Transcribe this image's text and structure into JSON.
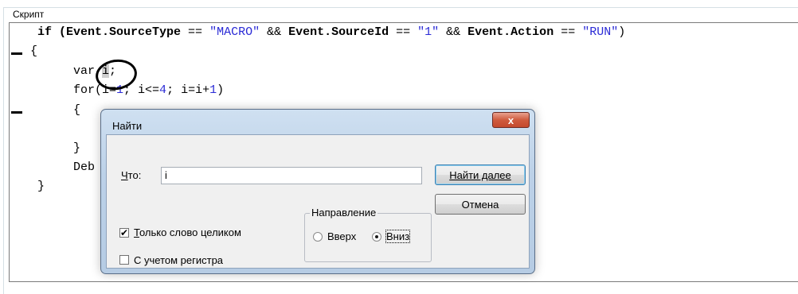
{
  "groupbox": {
    "title": "Скрипт"
  },
  "code": {
    "line1": {
      "a": "if (",
      "b": "Event.SourceType",
      "c": " == ",
      "d": "\"MACRO\"",
      "e": " && ",
      "f": "Event.SourceId",
      "g": " == ",
      "h": "\"1\"",
      "i": " && ",
      "j": "Event.Action",
      "k": " == ",
      "l": "\"RUN\"",
      "m": ")"
    },
    "line2": "{",
    "line3_a": "var ",
    "line3_b": "i",
    "line3_c": ";",
    "line4_a": "for(i=",
    "line4_b": "1",
    "line4_c": "; i<=",
    "line4_d": "4",
    "line4_e": "; i=i+",
    "line4_f": "1",
    "line4_g": ")",
    "line5": "{",
    "line7": "}",
    "line8": "Deb",
    "line9": "}"
  },
  "dialog": {
    "title": "Найти",
    "close_label": "x",
    "what_label_u": "Ч",
    "what_label_rest": "то:",
    "what_value": "i",
    "find_next": "Найти далее",
    "cancel": "Отмена",
    "whole_word": {
      "label_u": "Т",
      "label_rest": "олько слово целиком",
      "checked": true,
      "mark": "✔"
    },
    "match_case": {
      "label": "С учетом регистра",
      "checked": false
    },
    "direction": {
      "legend": "Направление",
      "up": "Вверх",
      "down": "Вниз",
      "selected": "down"
    }
  }
}
